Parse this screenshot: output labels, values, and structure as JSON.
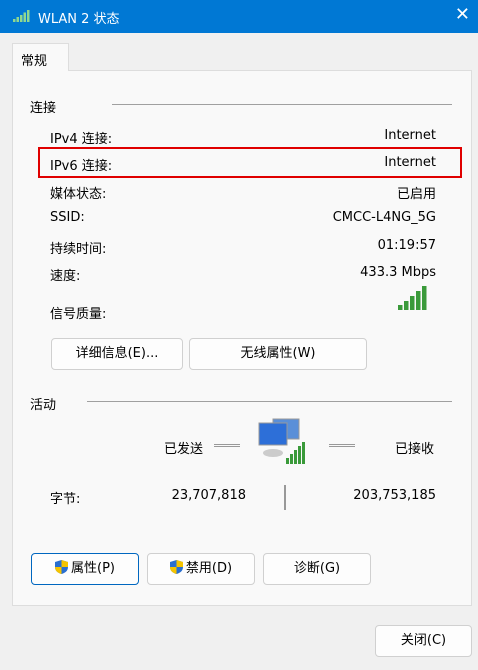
{
  "window": {
    "title": "WLAN 2 状态",
    "close": "✕"
  },
  "tabs": [
    {
      "label": "常规"
    }
  ],
  "connection": {
    "heading": "连接",
    "rows": [
      {
        "label": "IPv4 连接:",
        "value": "Internet"
      },
      {
        "label": "IPv6 连接:",
        "value": "Internet"
      },
      {
        "label": "媒体状态:",
        "value": "已启用"
      },
      {
        "label": "SSID:",
        "value": "CMCC-L4NG_5G"
      },
      {
        "label": "持续时间:",
        "value": "01:19:57"
      },
      {
        "label": "速度:",
        "value": "433.3 Mbps"
      },
      {
        "label": "信号质量:",
        "signal_bars": 5
      }
    ],
    "details_button": "详细信息(E)...",
    "wireless_button": "无线属性(W)"
  },
  "activity": {
    "heading": "活动",
    "sent_label": "已发送",
    "received_label": "已接收",
    "bytes_label": "字节:",
    "sent": "23,707,818",
    "received": "203,753,185"
  },
  "buttons": {
    "properties": "属性(P)",
    "disable": "禁用(D)",
    "diagnose": "诊断(G)",
    "close": "关闭(C)"
  },
  "colors": {
    "titlebar": "#0078d4",
    "highlight": "#e00000",
    "signal": "#3a9a3a"
  }
}
